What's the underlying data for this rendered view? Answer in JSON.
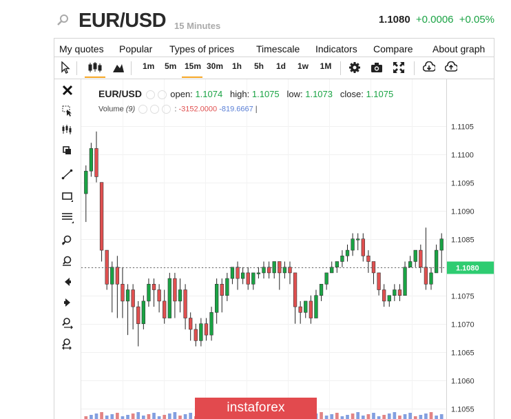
{
  "header": {
    "symbol": "EUR/USD",
    "interval": "15 Minutes",
    "last": "1.1080",
    "change": "+0.0006",
    "change_pct": "+0.05%"
  },
  "menu": [
    "My quotes",
    "Popular",
    "Types of prices",
    "Timescale",
    "Indicators",
    "Compare",
    "About graph"
  ],
  "toolbar": {
    "timeframes": [
      "1m",
      "5m",
      "15m",
      "30m",
      "1h",
      "5h",
      "1d",
      "1w",
      "1M"
    ],
    "active_timeframe": "15m"
  },
  "legend": {
    "symbol": "EUR/USD",
    "open_label": "open:",
    "open": "1.1074",
    "high_label": "high:",
    "high": "1.1075",
    "low_label": "low:",
    "low": "1.1073",
    "close_label": "close:",
    "close": "1.1075",
    "volume_label": "Volume",
    "volume_period": "(9)",
    "vol1": "-3152.0000",
    "vol2": "-819.6667"
  },
  "watermark": "instaforex",
  "colors": {
    "up": "#1aa344",
    "down": "#e05050",
    "current_price_bg": "#2ecc71",
    "volume_up": "#d95b5b",
    "volume_down": "#5a7fd6"
  },
  "chart_data": {
    "type": "candlestick",
    "y_ticks": [
      "1.1105",
      "1.1100",
      "1.1095",
      "1.1090",
      "1.1085",
      "1.1080",
      "1.1075",
      "1.1070",
      "1.1065",
      "1.1060",
      "1.1055"
    ],
    "ylim": [
      1.1054,
      1.1108
    ],
    "current_price": 1.108,
    "current_price_label": "1.1080",
    "candles": [
      [
        1.1093,
        1.1097,
        1.1088,
        1.1098
      ],
      [
        1.1097,
        1.1101,
        1.1096,
        1.1102
      ],
      [
        1.1101,
        1.1096,
        1.1095,
        1.1104
      ],
      [
        1.1095,
        1.1083,
        1.1081,
        1.1095
      ],
      [
        1.1083,
        1.1077,
        1.1076,
        1.1083
      ],
      [
        1.1077,
        1.108,
        1.1072,
        1.1081
      ],
      [
        1.108,
        1.1077,
        1.1071,
        1.1082
      ],
      [
        1.1077,
        1.1074,
        1.1071,
        1.108
      ],
      [
        1.1074,
        1.1076,
        1.1068,
        1.1077
      ],
      [
        1.1076,
        1.1073,
        1.1069,
        1.1077
      ],
      [
        1.1073,
        1.107,
        1.1066,
        1.1074
      ],
      [
        1.107,
        1.1074,
        1.1069,
        1.1075
      ],
      [
        1.1074,
        1.1077,
        1.1073,
        1.1078
      ],
      [
        1.1077,
        1.1076,
        1.1073,
        1.1078
      ],
      [
        1.1076,
        1.1074,
        1.1072,
        1.1077
      ],
      [
        1.1074,
        1.1071,
        1.107,
        1.1076
      ],
      [
        1.1071,
        1.1078,
        1.1071,
        1.1079
      ],
      [
        1.1078,
        1.1074,
        1.1071,
        1.1079
      ],
      [
        1.1074,
        1.1076,
        1.1072,
        1.1078
      ],
      [
        1.1076,
        1.1071,
        1.1069,
        1.1077
      ],
      [
        1.1071,
        1.1069,
        1.1067,
        1.1072
      ],
      [
        1.1069,
        1.1067,
        1.1066,
        1.107
      ],
      [
        1.1067,
        1.107,
        1.1066,
        1.1071
      ],
      [
        1.107,
        1.1068,
        1.1067,
        1.1071
      ],
      [
        1.1068,
        1.1072,
        1.1067,
        1.1073
      ],
      [
        1.1072,
        1.1077,
        1.107,
        1.1078
      ],
      [
        1.1077,
        1.1075,
        1.1072,
        1.1078
      ],
      [
        1.1075,
        1.1078,
        1.1074,
        1.1079
      ],
      [
        1.1078,
        1.108,
        1.1077,
        1.108
      ],
      [
        1.108,
        1.1078,
        1.1076,
        1.1081
      ],
      [
        1.1078,
        1.1079,
        1.1077,
        1.108
      ],
      [
        1.1079,
        1.1077,
        1.1076,
        1.108
      ],
      [
        1.1077,
        1.1079,
        1.1076,
        1.1079
      ],
      [
        1.1079,
        1.1079,
        1.1078,
        1.108
      ],
      [
        1.1079,
        1.108,
        1.1078,
        1.1081
      ],
      [
        1.108,
        1.1079,
        1.1078,
        1.1081
      ],
      [
        1.1079,
        1.1081,
        1.1078,
        1.1081
      ],
      [
        1.1081,
        1.1079,
        1.1076,
        1.1081
      ],
      [
        1.1079,
        1.108,
        1.1078,
        1.1081
      ],
      [
        1.108,
        1.1079,
        1.1077,
        1.1081
      ],
      [
        1.1079,
        1.1073,
        1.107,
        1.1079
      ],
      [
        1.1073,
        1.1072,
        1.107,
        1.1074
      ],
      [
        1.1072,
        1.1074,
        1.1071,
        1.1074
      ],
      [
        1.1074,
        1.1071,
        1.107,
        1.1075
      ],
      [
        1.1071,
        1.1075,
        1.1071,
        1.1076
      ],
      [
        1.1075,
        1.1077,
        1.1074,
        1.1077
      ],
      [
        1.1077,
        1.1079,
        1.1076,
        1.1079
      ],
      [
        1.1079,
        1.108,
        1.1079,
        1.1081
      ],
      [
        1.108,
        1.1081,
        1.1079,
        1.1081
      ],
      [
        1.1081,
        1.1082,
        1.108,
        1.1083
      ],
      [
        1.1082,
        1.1083,
        1.1081,
        1.1084
      ],
      [
        1.1083,
        1.1085,
        1.1082,
        1.1086
      ],
      [
        1.1085,
        1.1085,
        1.1083,
        1.1086
      ],
      [
        1.1085,
        1.1082,
        1.1081,
        1.1086
      ],
      [
        1.1082,
        1.1081,
        1.1079,
        1.1083
      ],
      [
        1.1081,
        1.1079,
        1.1077,
        1.1081
      ],
      [
        1.1079,
        1.1076,
        1.1075,
        1.1079
      ],
      [
        1.1076,
        1.1074,
        1.1073,
        1.1077
      ],
      [
        1.1074,
        1.1075,
        1.1073,
        1.1075
      ],
      [
        1.1075,
        1.1076,
        1.1074,
        1.1077
      ],
      [
        1.1076,
        1.1075,
        1.1074,
        1.1077
      ],
      [
        1.1075,
        1.108,
        1.1075,
        1.1081
      ],
      [
        1.108,
        1.1081,
        1.108,
        1.1082
      ],
      [
        1.1081,
        1.1083,
        1.108,
        1.1083
      ],
      [
        1.1083,
        1.108,
        1.1079,
        1.1084
      ],
      [
        1.108,
        1.1077,
        1.1076,
        1.1087
      ],
      [
        1.1077,
        1.1079,
        1.1076,
        1.108
      ],
      [
        1.1079,
        1.1083,
        1.1079,
        1.1084
      ],
      [
        1.1083,
        1.1085,
        1.1079,
        1.1086
      ]
    ]
  }
}
